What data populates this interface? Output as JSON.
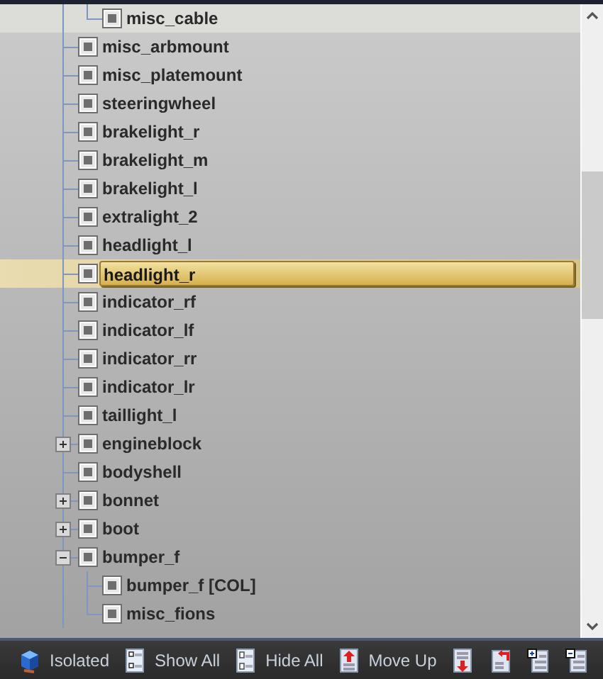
{
  "tree": {
    "continued_children": [
      {
        "label": "misc_cable",
        "checked": true,
        "selected": false
      }
    ],
    "items": [
      {
        "label": "misc_arbmount",
        "checked": true,
        "selected": false
      },
      {
        "label": "misc_platemount",
        "checked": true,
        "selected": false
      },
      {
        "label": "steeringwheel",
        "checked": true,
        "selected": false
      },
      {
        "label": "brakelight_r",
        "checked": true,
        "selected": false
      },
      {
        "label": "brakelight_m",
        "checked": true,
        "selected": false
      },
      {
        "label": "brakelight_l",
        "checked": true,
        "selected": false
      },
      {
        "label": "extralight_2",
        "checked": true,
        "selected": false
      },
      {
        "label": "headlight_l",
        "checked": true,
        "selected": false
      },
      {
        "label": "headlight_r",
        "checked": true,
        "selected": true
      },
      {
        "label": "indicator_rf",
        "checked": true,
        "selected": false
      },
      {
        "label": "indicator_lf",
        "checked": true,
        "selected": false
      },
      {
        "label": "indicator_rr",
        "checked": true,
        "selected": false
      },
      {
        "label": "indicator_lr",
        "checked": true,
        "selected": false
      },
      {
        "label": "taillight_l",
        "checked": true,
        "selected": false
      },
      {
        "label": "engineblock",
        "checked": true,
        "selected": false,
        "expanded": false
      },
      {
        "label": "bodyshell",
        "checked": true,
        "selected": false
      },
      {
        "label": "bonnet",
        "checked": true,
        "selected": false,
        "expanded": false
      },
      {
        "label": "boot",
        "checked": true,
        "selected": false,
        "expanded": false
      },
      {
        "label": "bumper_f",
        "checked": true,
        "selected": false,
        "expanded": true,
        "children": [
          {
            "label": "bumper_f [COL]",
            "checked": true,
            "selected": false
          },
          {
            "label": "misc_fions",
            "checked": true,
            "selected": false
          }
        ]
      }
    ]
  },
  "toolbar": [
    {
      "kind": "cube",
      "label": "Isolated"
    },
    {
      "kind": "show",
      "label": "Show All"
    },
    {
      "kind": "hide",
      "label": "Hide All"
    },
    {
      "kind": "up",
      "label": "Move Up"
    },
    {
      "kind": "down"
    },
    {
      "kind": "back"
    },
    {
      "kind": "expand"
    },
    {
      "kind": "collapse"
    }
  ]
}
